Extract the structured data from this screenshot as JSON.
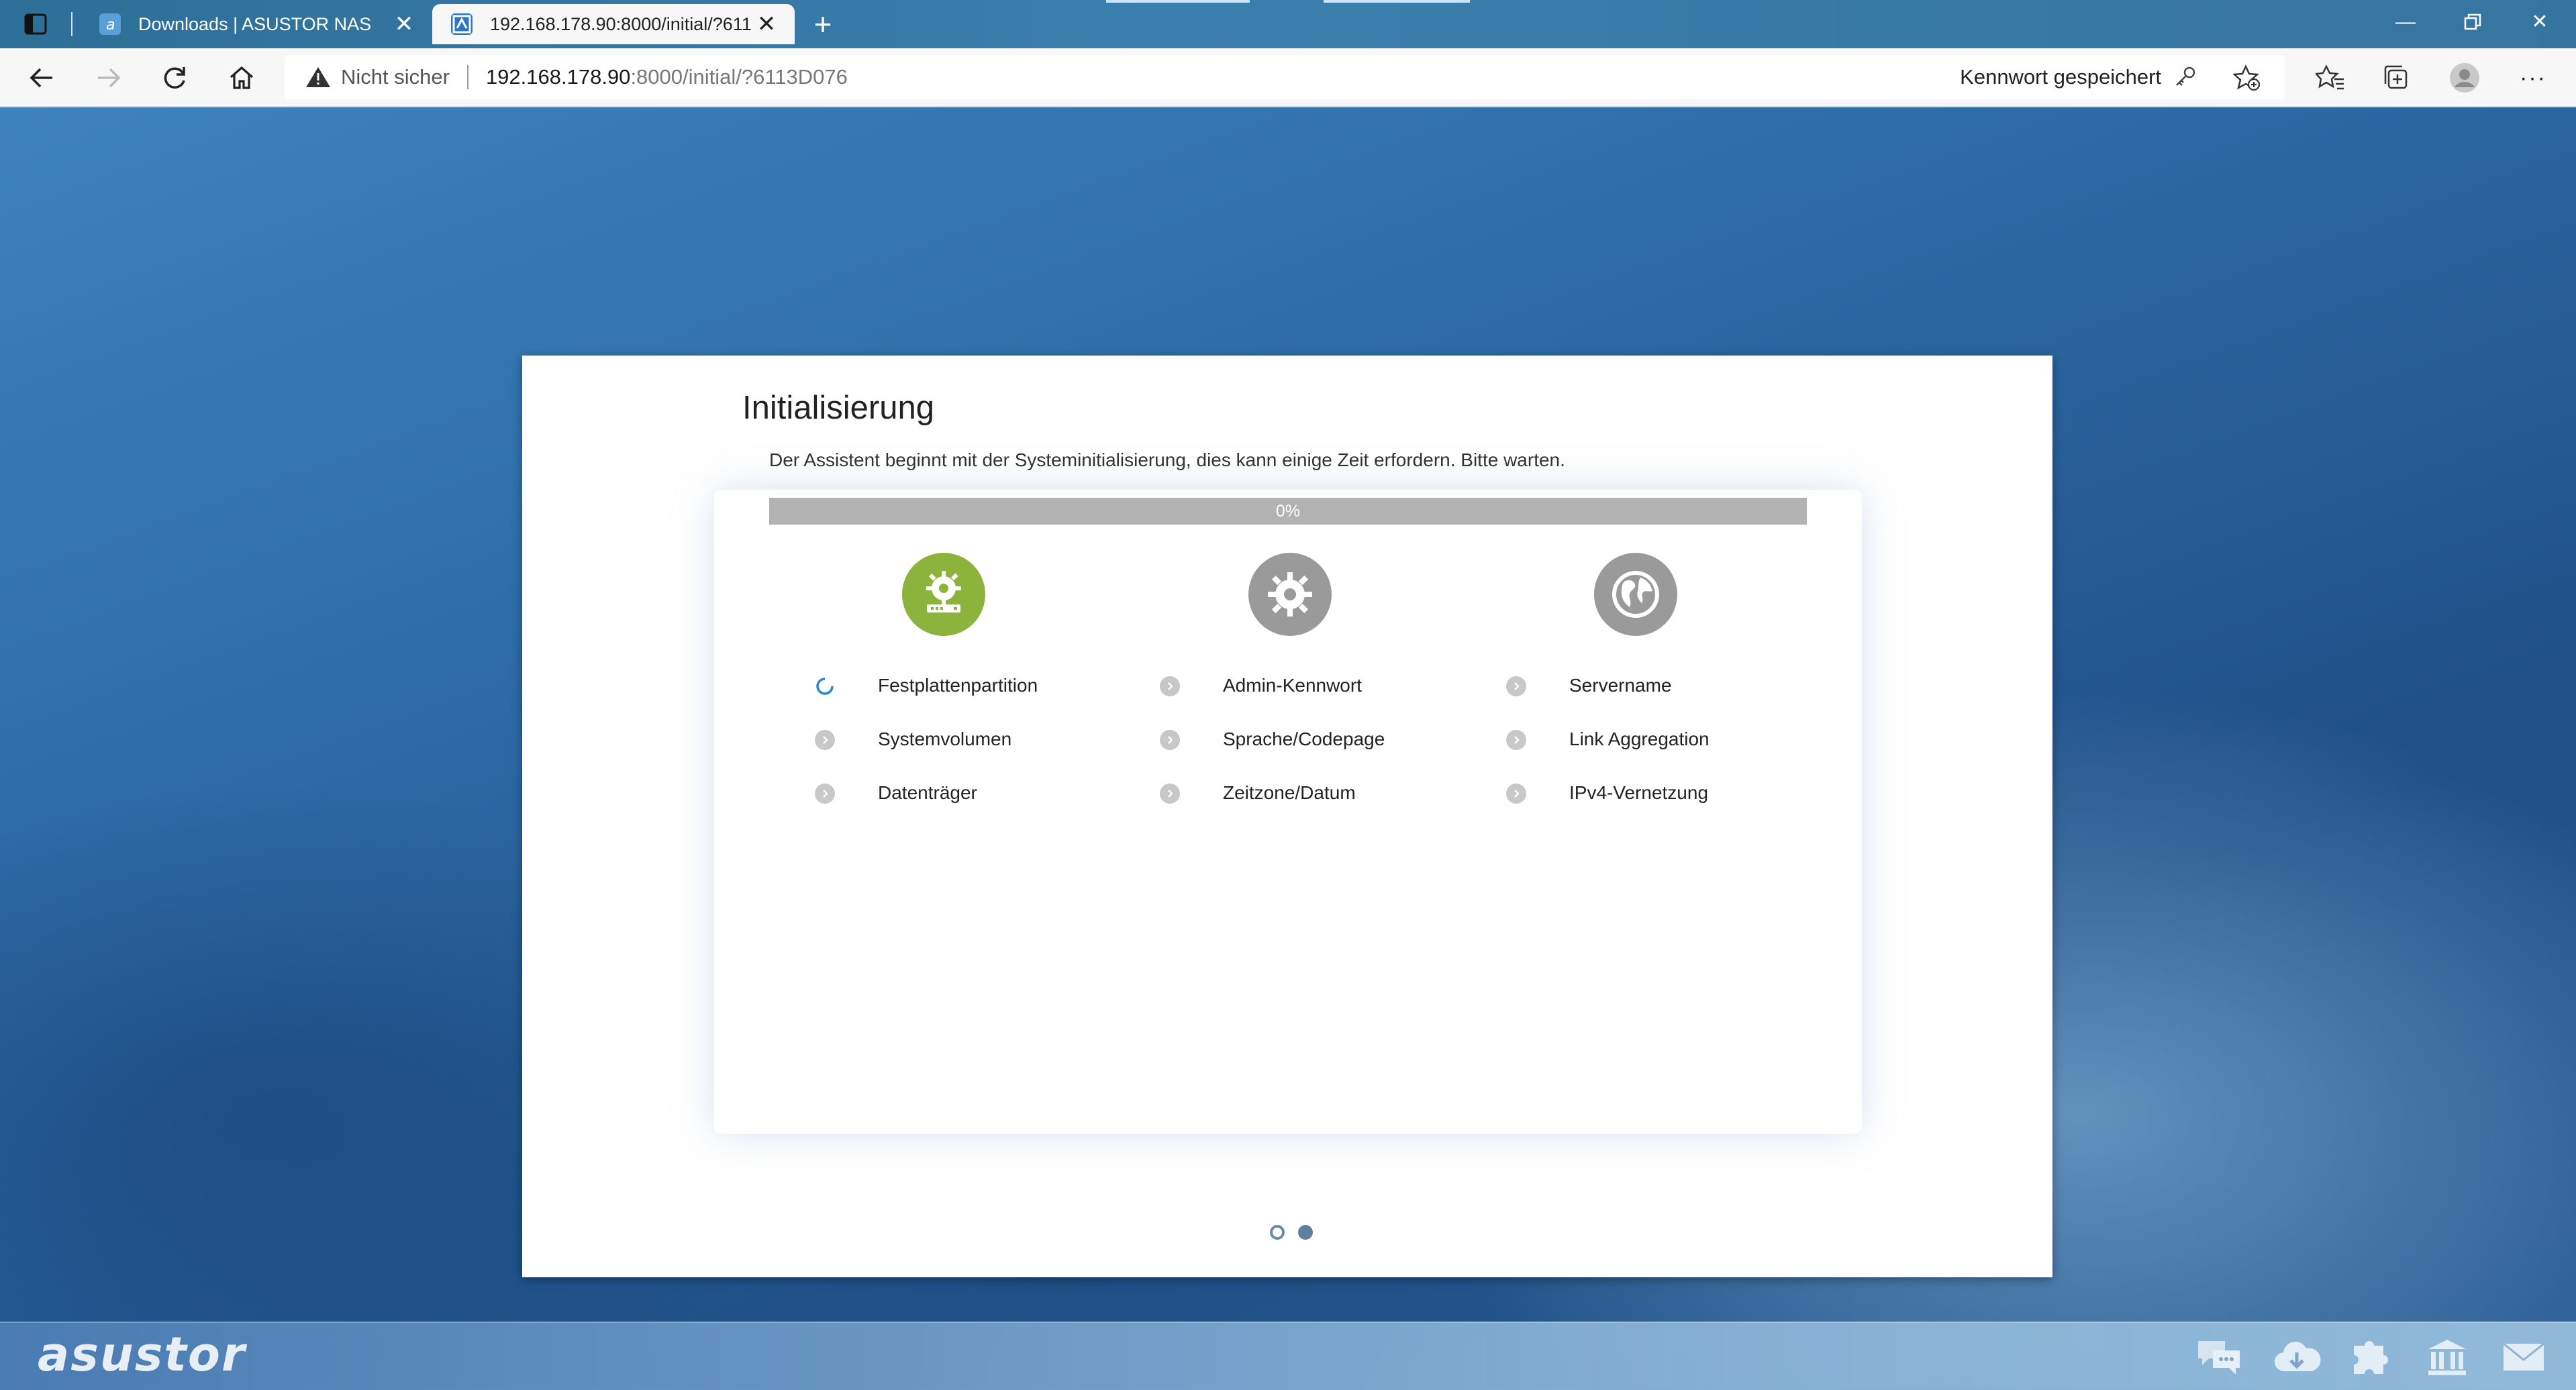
{
  "browser": {
    "tabs": [
      {
        "label": "Downloads | ASUSTOR NAS",
        "active": false
      },
      {
        "label": "192.168.178.90:8000/initial/?611",
        "active": true
      }
    ],
    "new_tab_symbol": "+",
    "address": {
      "security_label": "Nicht sicher",
      "url_host": "192.168.178.90",
      "url_rest": ":8000/initial/?6113D076"
    },
    "password_saved_label": "Kennwort gespeichert"
  },
  "wizard": {
    "title": "Initialisierung",
    "description": "Der Assistent beginnt mit der Systeminitialisierung, dies kann einige Zeit erfordern. Bitte warten.",
    "progress_percent": 0,
    "progress_label": "0%",
    "stages": [
      {
        "icon": "disk-gear-icon",
        "color": "#8cb43c",
        "steps": [
          {
            "label": "Festplattenpartition",
            "state": "in-progress"
          },
          {
            "label": "Systemvolumen",
            "state": "pending"
          },
          {
            "label": "Datenträger",
            "state": "pending"
          }
        ]
      },
      {
        "icon": "gear-icon",
        "color": "#9a9a9a",
        "steps": [
          {
            "label": "Admin-Kennwort",
            "state": "pending"
          },
          {
            "label": "Sprache/Codepage",
            "state": "pending"
          },
          {
            "label": "Zeitzone/Datum",
            "state": "pending"
          }
        ]
      },
      {
        "icon": "globe-icon",
        "color": "#9a9a9a",
        "steps": [
          {
            "label": "Servername",
            "state": "pending"
          },
          {
            "label": "Link Aggregation",
            "state": "pending"
          },
          {
            "label": "IPv4-Vernetzung",
            "state": "pending"
          }
        ]
      }
    ],
    "pager": {
      "pages": 2,
      "current": 1
    }
  },
  "footer": {
    "brand": "asustor",
    "dock_icons": [
      "chat-icon",
      "cloud-download-icon",
      "plugin-icon",
      "bank-icon",
      "mail-icon"
    ]
  },
  "colors": {
    "accent": "#8cb43c",
    "pending": "#c8c8c8",
    "spinner": "#2a86d0"
  }
}
